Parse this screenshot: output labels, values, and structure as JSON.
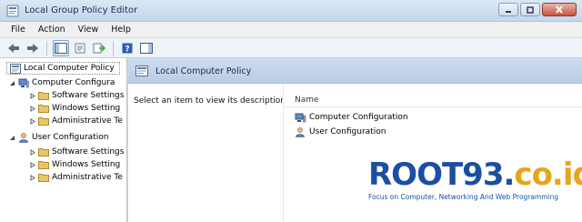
{
  "window": {
    "title": "Local Group Policy Editor"
  },
  "menu": [
    "File",
    "Action",
    "View",
    "Help"
  ],
  "tree": {
    "root": "Local Computer Policy",
    "computer": "Computer Configura",
    "computer_children": [
      "Software Settings",
      "Windows Setting",
      "Administrative Te"
    ],
    "user": "User Configuration",
    "user_children": [
      "Software Settings",
      "Windows Setting",
      "Administrative Te"
    ]
  },
  "content": {
    "header_title": "Local Computer Policy",
    "description": "Select an item to view its description.",
    "column_name": "Name",
    "items": [
      "Computer Configuration",
      "User Configuration"
    ]
  },
  "watermark": {
    "brand": "ROOT93",
    "dot": ".",
    "tld": "co.id",
    "tagline": "Focus on Computer, Networking And Web Programming"
  },
  "colors": {
    "titlebar": "#c4d6ec",
    "header": "#b9cde6",
    "brand_blue": "#1b4fa1",
    "brand_orange": "#e8a51a",
    "folder": "#e8c76a"
  },
  "icons": {
    "app": "group-policy-icon",
    "back": "back-arrow-icon",
    "forward": "forward-arrow-icon",
    "folder": "folder-icon",
    "computer": "computer-icon",
    "user": "user-icon",
    "help": "help-icon"
  }
}
